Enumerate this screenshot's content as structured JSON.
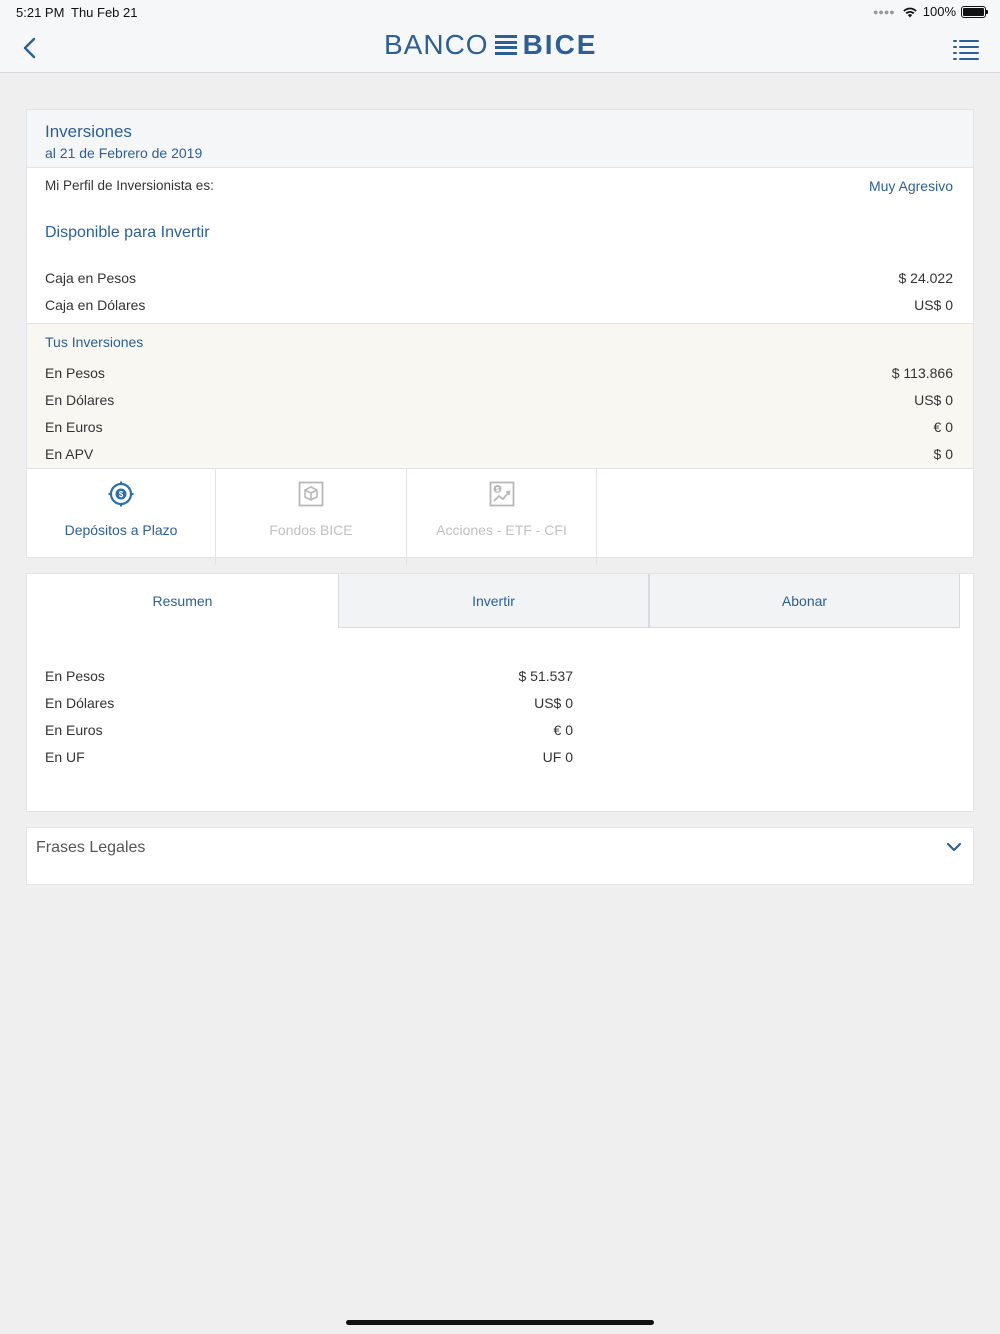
{
  "status": {
    "time": "5:21 PM",
    "date": "Thu Feb 21",
    "battery": "100%"
  },
  "header": {
    "logo_left": "BANCO",
    "logo_right": "BICE",
    "brand_color": "#2d5f95"
  },
  "investments": {
    "title": "Inversiones",
    "date": "al 21 de Febrero de 2019",
    "profile_label": "Mi Perfil de Inversionista es:",
    "profile_value": "Muy Agresivo",
    "available_title": "Disponible para Invertir",
    "available": [
      {
        "label": "Caja en Pesos",
        "value": "$ 24.022"
      },
      {
        "label": "Caja en Dólares",
        "value": "US$ 0"
      }
    ],
    "yours_title": "Tus Inversiones",
    "yours": [
      {
        "label": "En Pesos",
        "value": "$ 113.866"
      },
      {
        "label": "En Dólares",
        "value": "US$ 0"
      },
      {
        "label": "En Euros",
        "value": "€ 0"
      },
      {
        "label": "En APV",
        "value": "$ 0"
      }
    ],
    "products": [
      {
        "label": "Depósitos a Plazo",
        "icon": "dollar-target-icon",
        "state": "active"
      },
      {
        "label": "Fondos BICE",
        "icon": "box-icon",
        "state": "disabled"
      },
      {
        "label": "Acciones - ETF - CFI",
        "icon": "chart-dollar-icon",
        "state": "disabled"
      }
    ]
  },
  "tabs": [
    {
      "label": "Resumen",
      "active": true
    },
    {
      "label": "Invertir",
      "active": false
    },
    {
      "label": "Abonar",
      "active": false
    }
  ],
  "summary": [
    {
      "label": "En Pesos",
      "value": "$ 51.537"
    },
    {
      "label": "En Dólares",
      "value": "US$ 0"
    },
    {
      "label": "En Euros",
      "value": "€ 0"
    },
    {
      "label": "En UF",
      "value": "UF 0"
    }
  ],
  "legal": {
    "label": "Frases Legales"
  }
}
